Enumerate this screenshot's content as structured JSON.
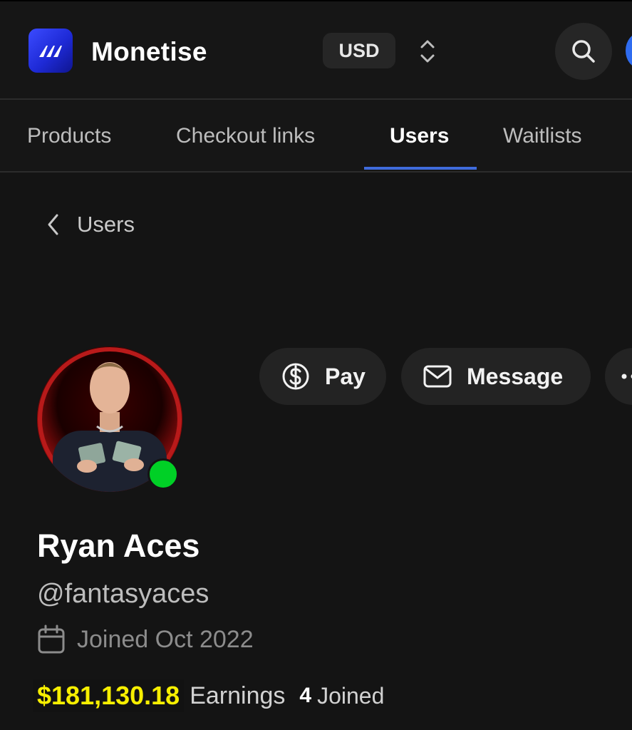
{
  "app": {
    "name": "Monetise"
  },
  "header": {
    "currency": "USD"
  },
  "tabs": [
    {
      "label": "Products",
      "active": false
    },
    {
      "label": "Checkout links",
      "active": false
    },
    {
      "label": "Users",
      "active": true
    },
    {
      "label": "Waitlists",
      "active": false
    }
  ],
  "breadcrumb": {
    "label": "Users"
  },
  "actions": {
    "pay": "Pay",
    "message": "Message"
  },
  "profile": {
    "name": "Ryan Aces",
    "handle": "@fantasyaces",
    "joined": "Joined Oct 2022",
    "online": true,
    "earnings": "$181,130.18",
    "earnings_label": "Earnings",
    "joined_count": "4",
    "joined_count_label": "Joined"
  },
  "colors": {
    "background": "#141414",
    "accent": "#3f6bdc",
    "earnings_highlight": "#f7ef00",
    "online": "#00d026"
  }
}
